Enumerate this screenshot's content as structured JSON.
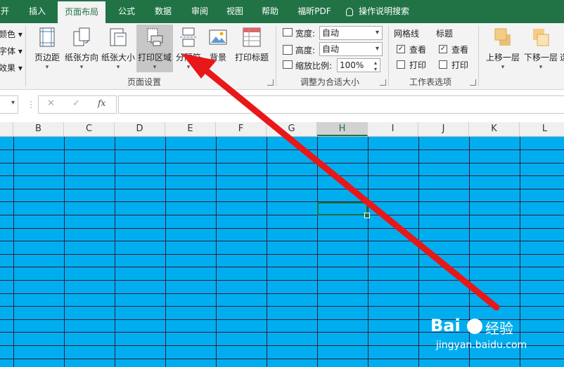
{
  "ribbon_tabs": [
    "开始",
    "插入",
    "页面布局",
    "公式",
    "数据",
    "审阅",
    "视图",
    "帮助",
    "福昕PDF",
    "操作说明搜索"
  ],
  "active_tab": "页面布局",
  "theme_group": {
    "items": [
      "颜色",
      "字体",
      "效果"
    ]
  },
  "page_setup": {
    "buttons": [
      "页边距",
      "纸张方向",
      "纸张大小",
      "打印区域",
      "分隔符",
      "背景",
      "打印标题"
    ],
    "label": "页面设置"
  },
  "scale_fit": {
    "width_label": "宽度:",
    "width_value": "自动",
    "height_label": "高度:",
    "height_value": "自动",
    "scale_label": "缩放比例:",
    "scale_value": "100%",
    "label": "调整为合适大小"
  },
  "sheet_options": {
    "gridlines_title": "网格线",
    "headings_title": "标题",
    "view": "查看",
    "print": "打印",
    "gridlines_view_checked": true,
    "gridlines_print_checked": false,
    "headings_view_checked": true,
    "headings_print_checked": false,
    "label": "工作表选项"
  },
  "arrange": {
    "bring_forward": "上移一层",
    "send_backward": "下移一层"
  },
  "formula_bar": {
    "fx": "fx",
    "cancel": "✕",
    "enter": "✓"
  },
  "columns": [
    "B",
    "C",
    "D",
    "E",
    "F",
    "G",
    "H",
    "I",
    "J",
    "K",
    "L"
  ],
  "selected_column": "H",
  "colors": {
    "ribbon_green": "#217346",
    "sheet_fill": "#00aeef",
    "arrow_red": "#e8181a"
  },
  "watermark": {
    "brand": "Bai",
    "brand_suffix": "经验",
    "url": "jingyan.baidu.com"
  }
}
